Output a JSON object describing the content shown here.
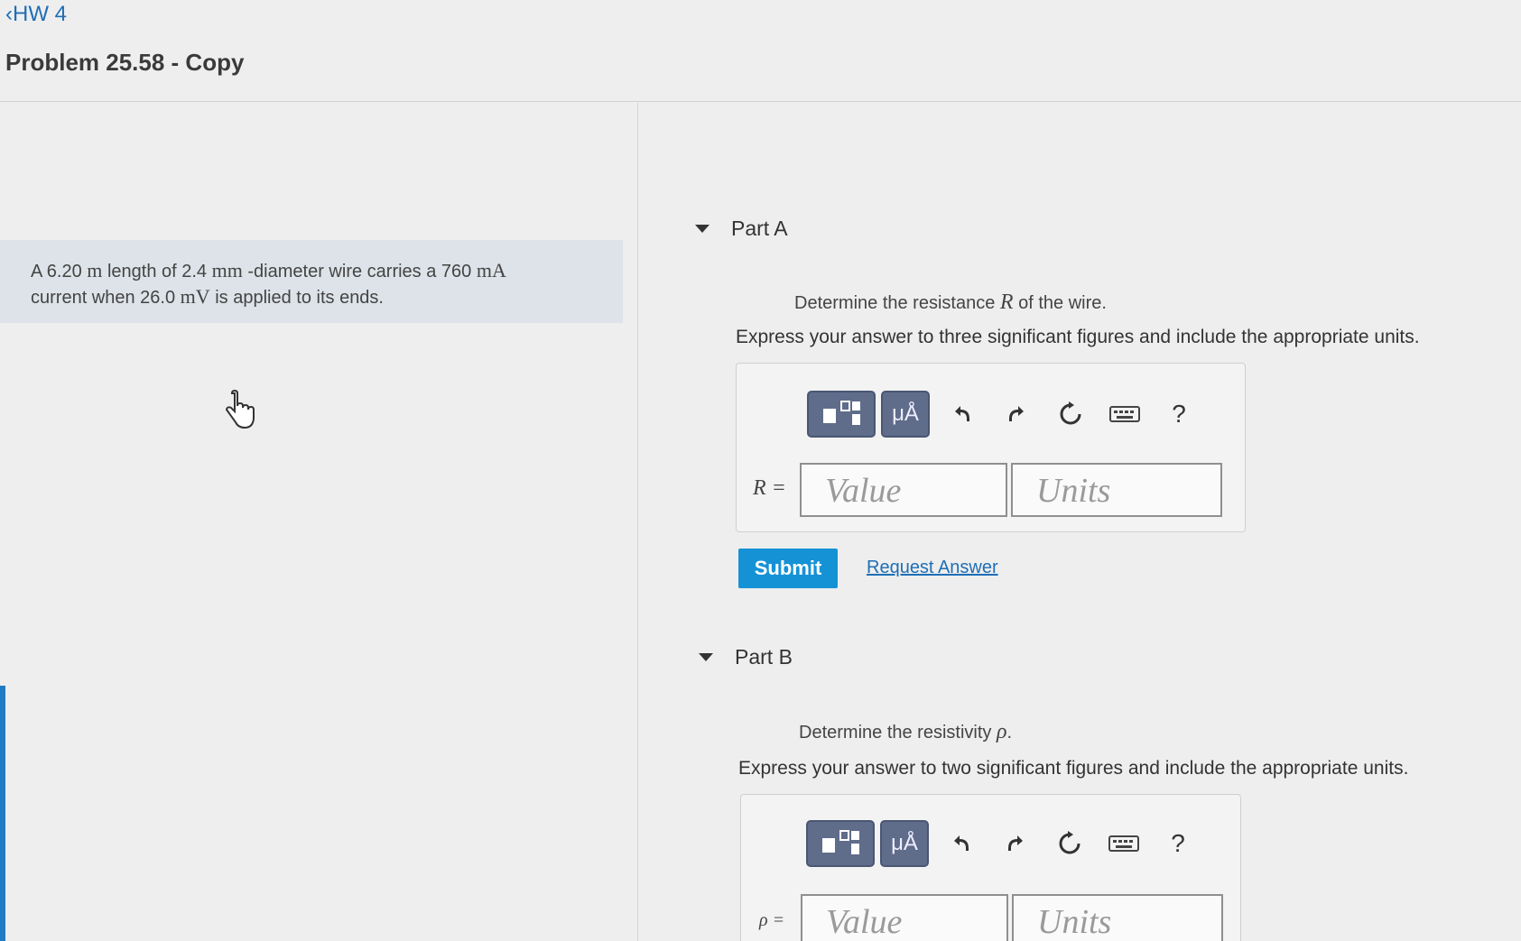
{
  "nav": {
    "back_label": "HW 4"
  },
  "page_title": "Problem 25.58 - Copy",
  "problem": {
    "t1": "A 6.20 ",
    "u1": "m",
    "t2": " length of 2.4 ",
    "u2": "mm",
    "t3": " -diameter wire carries a 760 ",
    "u3": "mA",
    "t4": "current when 26.0 ",
    "u4": "mV",
    "t5": " is applied to its ends."
  },
  "part_a": {
    "label": "Part A",
    "prompt_before": "Determine the resistance ",
    "prompt_var": "R",
    "prompt_after": " of the wire.",
    "instruction": "Express your answer to three significant figures and include the appropriate units.",
    "var_label": "R =",
    "value_placeholder": "Value",
    "units_placeholder": "Units",
    "help": "?",
    "units_btn": "μÅ",
    "submit": "Submit",
    "request": "Request Answer"
  },
  "part_b": {
    "label": "Part B",
    "prompt_before": "Determine the resistivity ",
    "prompt_var": "ρ",
    "prompt_after": ".",
    "instruction": "Express your answer to two significant figures and include the appropriate units.",
    "var_label": "ρ =",
    "value_placeholder": "Value",
    "units_placeholder": "Units",
    "help": "?",
    "units_btn": "μÅ"
  },
  "icons": {
    "back": "chevron-left-icon",
    "templates": "templates-icon",
    "undo": "undo-icon",
    "redo": "redo-icon",
    "reset": "reset-icon",
    "keyboard": "keyboard-icon",
    "help": "help-icon",
    "cursor": "hand-cursor-icon"
  },
  "colors": {
    "accent": "#1592d6",
    "link": "#1f6eb6",
    "toolbar": "#5f6c8a"
  }
}
